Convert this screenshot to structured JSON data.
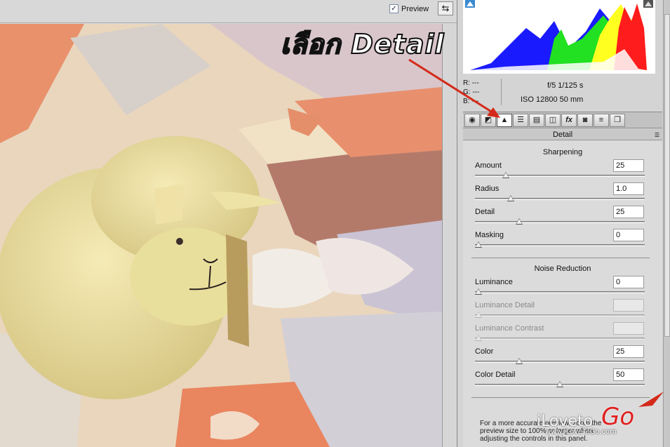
{
  "toolbar": {
    "preview_label": "Preview",
    "preview_checked": "✓"
  },
  "info": {
    "r": "R:   ---",
    "g": "G:   ---",
    "b": "B:   ---",
    "aperture_shutter": "f/5    1/125 s",
    "iso_focal": "ISO 12800    50 mm"
  },
  "tabs": [
    {
      "icon": "basic-icon",
      "glyph": "◉"
    },
    {
      "icon": "tone-curve-icon",
      "glyph": "◩"
    },
    {
      "icon": "detail-icon",
      "glyph": "▲"
    },
    {
      "icon": "hsl-icon",
      "glyph": "☰"
    },
    {
      "icon": "split-toning-icon",
      "glyph": "▤"
    },
    {
      "icon": "lens-corrections-icon",
      "glyph": "◫"
    },
    {
      "icon": "effects-icon",
      "glyph": "fx"
    },
    {
      "icon": "camera-calibration-icon",
      "glyph": "◙"
    },
    {
      "icon": "presets-icon",
      "glyph": "≡"
    },
    {
      "icon": "snapshots-icon",
      "glyph": "❐"
    }
  ],
  "panel": {
    "title": "Detail",
    "sharpening": {
      "heading": "Sharpening",
      "amount": {
        "label": "Amount",
        "value": "25",
        "level": 0.17
      },
      "radius": {
        "label": "Radius",
        "value": "1.0",
        "level": 0.2
      },
      "detail": {
        "label": "Detail",
        "value": "25",
        "level": 0.25
      },
      "masking": {
        "label": "Masking",
        "value": "0",
        "level": 0
      }
    },
    "noise": {
      "heading": "Noise Reduction",
      "luminance": {
        "label": "Luminance",
        "value": "0",
        "level": 0
      },
      "luminance_detail": {
        "label": "Luminance Detail",
        "value": "",
        "level": 0
      },
      "luminance_contrast": {
        "label": "Luminance Contrast",
        "value": "",
        "level": 0
      },
      "color": {
        "label": "Color",
        "value": "25",
        "level": 0.25
      },
      "color_detail": {
        "label": "Color Detail",
        "value": "50",
        "level": 0.5
      }
    },
    "note": "For a more accurate preview, zoom the preview size to 100% or larger when adjusting the controls in this panel."
  },
  "annotation": {
    "text": "เลือก Detail"
  },
  "watermark": {
    "brand": "iLoveto",
    "go": "Go",
    "url": "www.iLoveToGo.com"
  },
  "colors": {
    "arrow": "#d42a1a",
    "histo_red": "#ff1c1c",
    "histo_green": "#22e022",
    "histo_blue": "#1a1aff",
    "histo_yellow": "#ffff20"
  }
}
